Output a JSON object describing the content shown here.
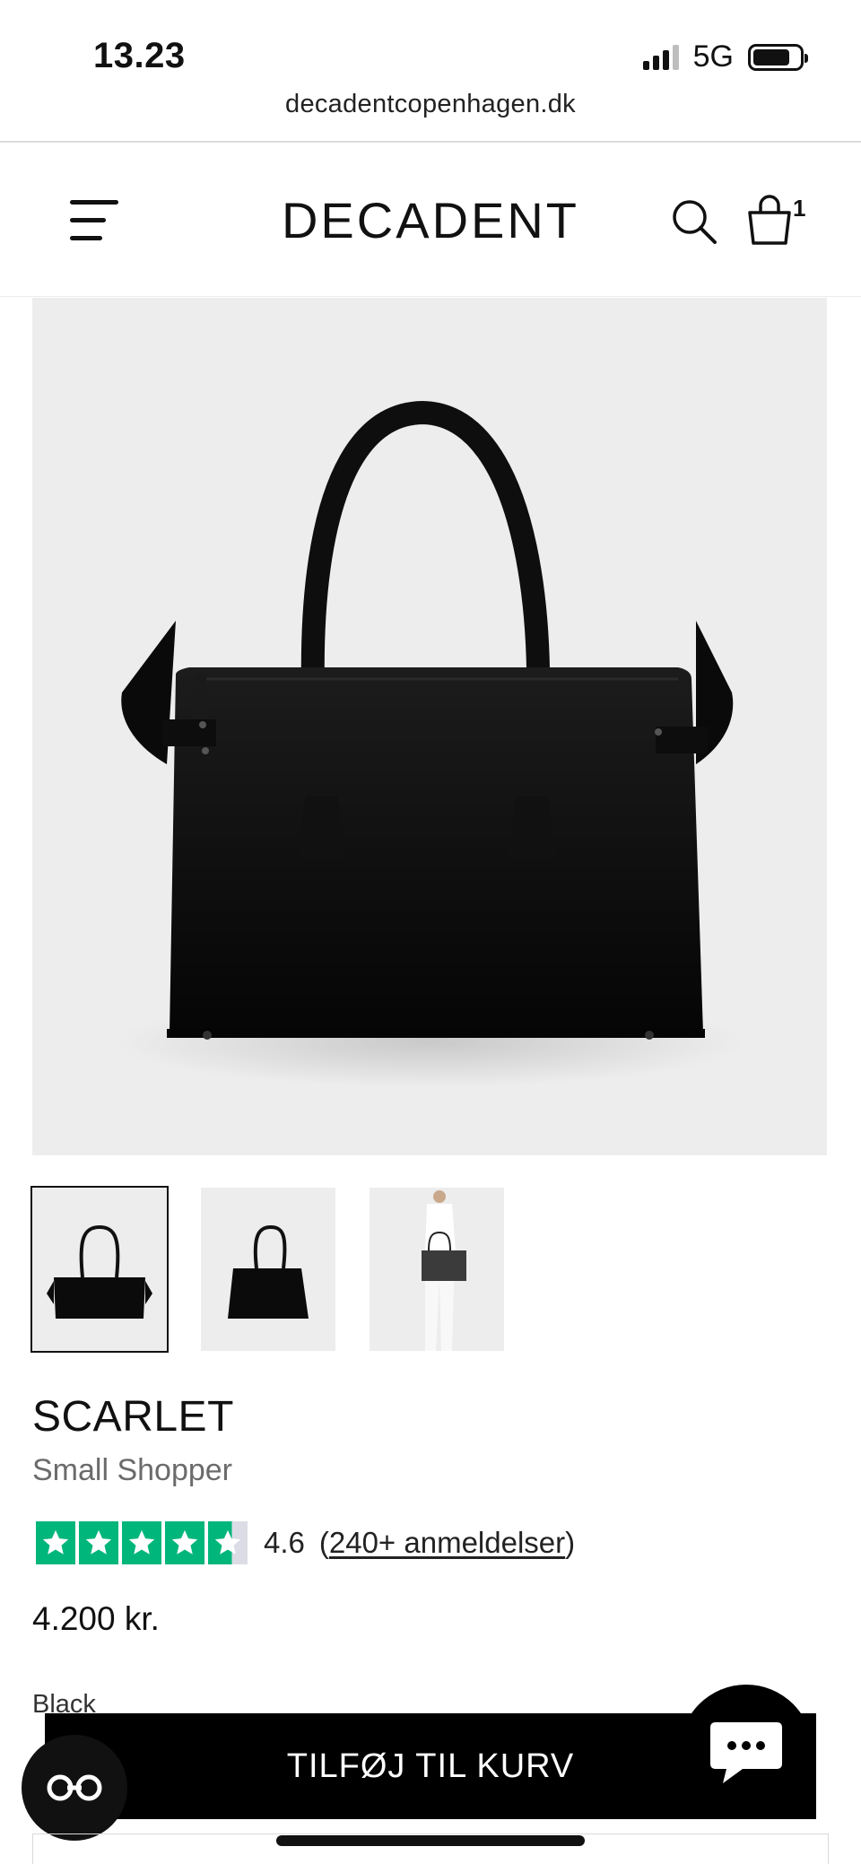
{
  "status_bar": {
    "time": "13.23",
    "network": "5G",
    "signal_bars": 4,
    "signal_active_bars": 3,
    "battery_level": 0.8
  },
  "browser": {
    "url": "decadentcopenhagen.dk"
  },
  "header": {
    "brand": "DECADENT",
    "menu_icon": "hamburger-menu-icon",
    "search_icon": "search-icon",
    "cart_icon": "shopping-bag-icon",
    "cart_count": "1"
  },
  "product": {
    "name": "SCARLET",
    "subtitle": "Small Shopper",
    "rating_value": "4.6",
    "reviews_open": "(",
    "reviews_text": "240+ anmeldelser",
    "reviews_close": ")",
    "rating_stars": 4.6,
    "price": "4.200 kr.",
    "color": "Black",
    "thumbnails": [
      {
        "name": "front",
        "selected": true
      },
      {
        "name": "side",
        "selected": false
      },
      {
        "name": "model",
        "selected": false
      }
    ]
  },
  "actions": {
    "add_to_cart": "TILFØJ TIL KURV",
    "chat_icon": "chat-bubble-icon",
    "accessibility_icon": "glasses-icon"
  },
  "colors": {
    "trustpilot_green": "#00b67a",
    "button_bg": "#000000",
    "image_bg": "#ededed"
  }
}
